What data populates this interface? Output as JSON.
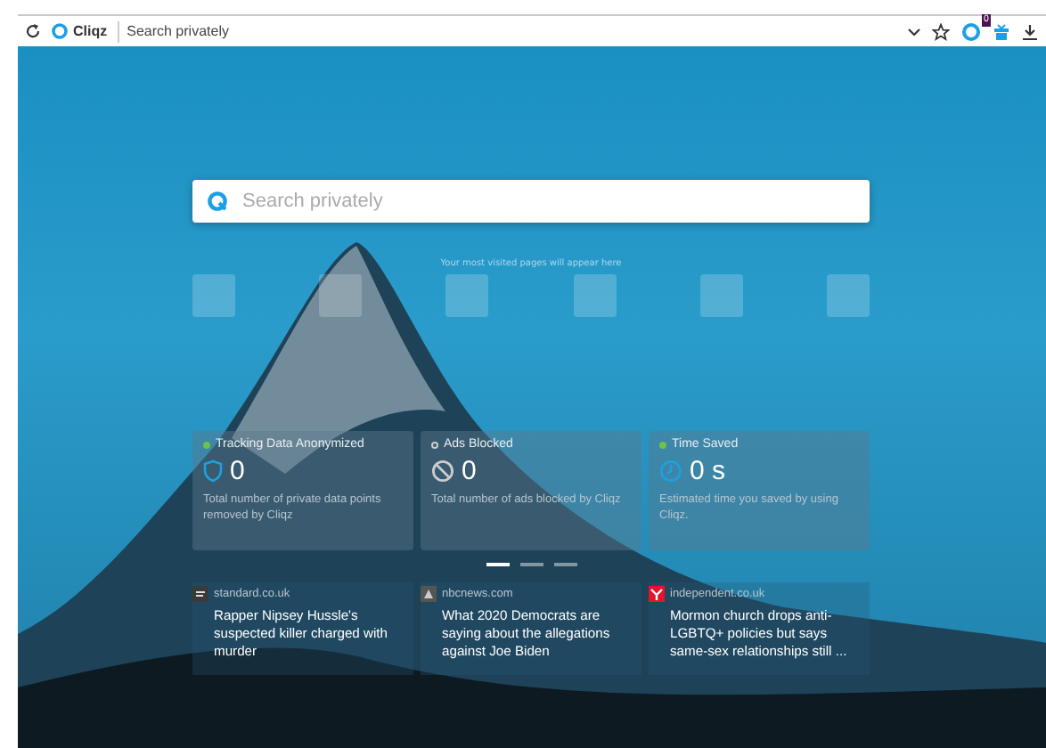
{
  "toolbar": {
    "brand": "Cliqz",
    "address": {
      "placeholder": "Search privately"
    },
    "extension_badge": "0"
  },
  "search": {
    "placeholder": "Search privately"
  },
  "speed_dial": {
    "caption": "Your most visited pages will appear here"
  },
  "stats": [
    {
      "title": "Tracking Data Anonymized",
      "on": true,
      "kind": "shield",
      "value": "0",
      "description": "Total number of private data points removed by Cliqz"
    },
    {
      "title": "Ads Blocked",
      "on": false,
      "kind": "block",
      "value": "0",
      "description": "Total number of ads blocked by Cliqz"
    },
    {
      "title": "Time Saved",
      "on": true,
      "kind": "clock",
      "value": "0 s",
      "description": "Estimated time you saved by using Cliqz."
    }
  ],
  "pager": [
    {
      "selected": true
    },
    {
      "selected": false
    },
    {
      "selected": false
    }
  ],
  "news": [
    {
      "source": "standard.co.uk",
      "kind": "standard",
      "headline": "Rapper Nipsey Hussle's suspected killer charged with murder"
    },
    {
      "source": "nbcnews.com",
      "kind": "nbc",
      "headline": "What 2020 Democrats are saying about the allegations against Joe Biden"
    },
    {
      "source": "independent.co.uk",
      "kind": "independent",
      "headline": "Mormon church drops anti-LGBTQ+ policies but says same-sex relationships still ..."
    }
  ]
}
